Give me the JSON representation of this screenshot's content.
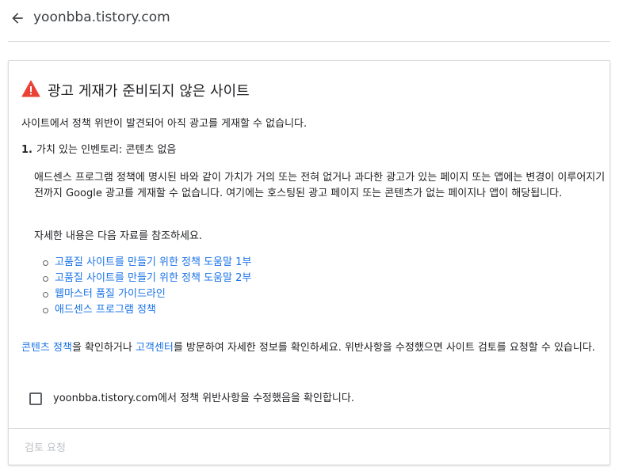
{
  "header": {
    "title": "yoonbba.tistory.com",
    "back_icon": "arrow-left-icon"
  },
  "card": {
    "title": "광고 게재가 준비되지 않은 사이트",
    "warning_icon": "warning-icon",
    "warning_color": "#ea4335",
    "intro": "사이트에서 정책 위반이 발견되어 아직 광고를 게재할 수 없습니다.",
    "violation": {
      "number": "1.",
      "text": "가치 있는 인벤토리: 콘텐츠 없음"
    },
    "description": "애드센스 프로그램 정책에 명시된 바와 같이 가치가 거의 또는 전혀 없거나 과다한 광고가 있는 페이지 또는 앱에는 변경이 이루어지기 전까지 Google 광고를 게재할 수 없습니다. 여기에는 호스팅된 광고 페이지 또는 콘텐츠가 없는 페이지나 앱이 해당됩니다.",
    "reference_intro": "자세한 내용은 다음 자료를 참조하세요.",
    "links": [
      "고품질 사이트를 만들기 위한 정책 도움말 1부",
      "고품질 사이트를 만들기 위한 정책 도움말 2부",
      "웹마스터 품질 가이드라인",
      "애드센스 프로그램 정책"
    ],
    "bottom": {
      "link1": "콘텐츠 정책",
      "text1": "을 확인하거나 ",
      "link2": "고객센터",
      "text2": "를 방문하여 자세한 정보를 확인하세요. 위반사항을 수정했으면 사이트 검토를 요청할 수 있습니다."
    },
    "checkbox_label": "yoonbba.tistory.com에서 정책 위반사항을 수정했음을 확인합니다.",
    "checkbox_checked": false,
    "review_button": "검토 요청"
  },
  "colors": {
    "link": "#1a73e8",
    "disabled": "#bdc1c6"
  }
}
